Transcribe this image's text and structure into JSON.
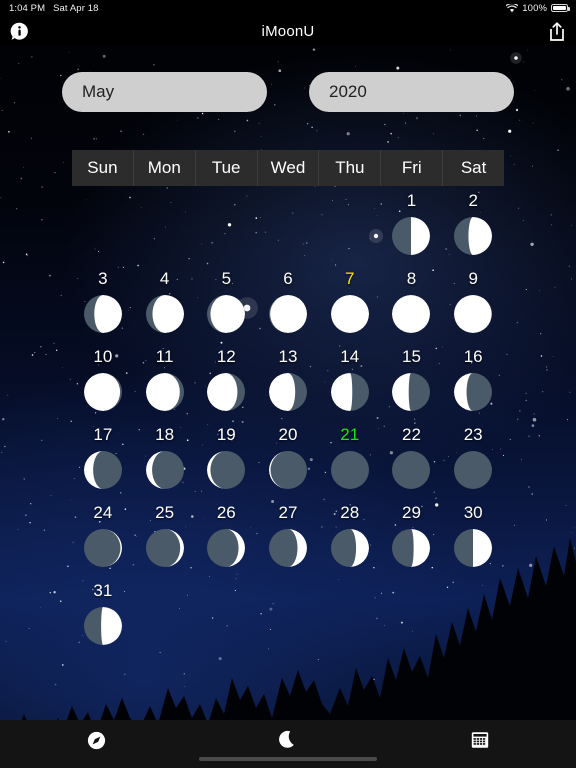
{
  "status_bar": {
    "time": "1:04 PM",
    "date": "Sat Apr 18",
    "wifi_icon": "wifi-icon",
    "battery_percent": "100%"
  },
  "title_bar": {
    "app_title": "iMoonU",
    "info_icon": "info-icon",
    "share_icon": "share-icon"
  },
  "selectors": {
    "month": "May",
    "year": "2020"
  },
  "day_headers": [
    "Sun",
    "Mon",
    "Tue",
    "Wed",
    "Thu",
    "Fri",
    "Sat"
  ],
  "colors": {
    "moon_dark": "#4b5a68",
    "moon_light": "#ffffff",
    "full_moon_label": "#ffe400",
    "new_moon_label": "#12e612",
    "header_bar": "#2c2c2c",
    "selector_field": "#cfcfcf",
    "tabbar": "#141414"
  },
  "tab_bar": {
    "tabs": [
      {
        "name": "compass-tab",
        "icon": "compass-icon",
        "label": ""
      },
      {
        "name": "moon-tab",
        "icon": "moon-icon",
        "label": ""
      },
      {
        "name": "calendar-tab",
        "icon": "calendar-icon",
        "label": ""
      }
    ]
  },
  "calendar": {
    "month": "May",
    "year": "2020",
    "first_day_column": 5,
    "days_in_month": 31,
    "weeks": [
      [
        null,
        null,
        null,
        null,
        null,
        1,
        2
      ],
      [
        3,
        4,
        5,
        6,
        7,
        8,
        9
      ],
      [
        10,
        11,
        12,
        13,
        14,
        15,
        16
      ],
      [
        17,
        18,
        19,
        20,
        21,
        22,
        23
      ],
      [
        24,
        25,
        26,
        27,
        28,
        29,
        30
      ],
      [
        31,
        null,
        null,
        null,
        null,
        null,
        null
      ]
    ],
    "days": [
      {
        "day": 1,
        "phase": "first-quarter",
        "illumination": 0.5,
        "lit_side": "right",
        "highlight": "none"
      },
      {
        "day": 2,
        "phase": "waxing-gibbous",
        "illumination": 0.62,
        "lit_side": "right",
        "highlight": "none"
      },
      {
        "day": 3,
        "phase": "waxing-gibbous",
        "illumination": 0.73,
        "lit_side": "right",
        "highlight": "none"
      },
      {
        "day": 4,
        "phase": "waxing-gibbous",
        "illumination": 0.83,
        "lit_side": "right",
        "highlight": "none"
      },
      {
        "day": 5,
        "phase": "waxing-gibbous",
        "illumination": 0.91,
        "lit_side": "right",
        "highlight": "none"
      },
      {
        "day": 6,
        "phase": "waxing-gibbous",
        "illumination": 0.97,
        "lit_side": "right",
        "highlight": "none"
      },
      {
        "day": 7,
        "phase": "full-moon",
        "illumination": 1.0,
        "lit_side": "right",
        "highlight": "full"
      },
      {
        "day": 8,
        "phase": "full-moon",
        "illumination": 1.0,
        "lit_side": "left",
        "highlight": "none"
      },
      {
        "day": 9,
        "phase": "waning-gibbous",
        "illumination": 0.99,
        "lit_side": "left",
        "highlight": "none"
      },
      {
        "day": 10,
        "phase": "waning-gibbous",
        "illumination": 0.95,
        "lit_side": "left",
        "highlight": "none"
      },
      {
        "day": 11,
        "phase": "waning-gibbous",
        "illumination": 0.89,
        "lit_side": "left",
        "highlight": "none"
      },
      {
        "day": 12,
        "phase": "waning-gibbous",
        "illumination": 0.8,
        "lit_side": "left",
        "highlight": "none"
      },
      {
        "day": 13,
        "phase": "waning-gibbous",
        "illumination": 0.69,
        "lit_side": "left",
        "highlight": "none"
      },
      {
        "day": 14,
        "phase": "last-quarter",
        "illumination": 0.56,
        "lit_side": "left",
        "highlight": "none"
      },
      {
        "day": 15,
        "phase": "last-quarter",
        "illumination": 0.44,
        "lit_side": "left",
        "highlight": "none"
      },
      {
        "day": 16,
        "phase": "waning-crescent",
        "illumination": 0.33,
        "lit_side": "left",
        "highlight": "none"
      },
      {
        "day": 17,
        "phase": "waning-crescent",
        "illumination": 0.24,
        "lit_side": "left",
        "highlight": "none"
      },
      {
        "day": 18,
        "phase": "waning-crescent",
        "illumination": 0.16,
        "lit_side": "left",
        "highlight": "none"
      },
      {
        "day": 19,
        "phase": "waning-crescent",
        "illumination": 0.09,
        "lit_side": "left",
        "highlight": "none"
      },
      {
        "day": 20,
        "phase": "waning-crescent",
        "illumination": 0.04,
        "lit_side": "left",
        "highlight": "none"
      },
      {
        "day": 21,
        "phase": "new-moon",
        "illumination": 0.0,
        "lit_side": "left",
        "highlight": "new"
      },
      {
        "day": 22,
        "phase": "new-moon",
        "illumination": 0.0,
        "lit_side": "right",
        "highlight": "none"
      },
      {
        "day": 23,
        "phase": "new-moon",
        "illumination": 0.0,
        "lit_side": "right",
        "highlight": "none"
      },
      {
        "day": 24,
        "phase": "waxing-crescent",
        "illumination": 0.04,
        "lit_side": "right",
        "highlight": "none"
      },
      {
        "day": 25,
        "phase": "waxing-crescent",
        "illumination": 0.1,
        "lit_side": "right",
        "highlight": "none"
      },
      {
        "day": 26,
        "phase": "waxing-crescent",
        "illumination": 0.17,
        "lit_side": "right",
        "highlight": "none"
      },
      {
        "day": 27,
        "phase": "waxing-crescent",
        "illumination": 0.25,
        "lit_side": "right",
        "highlight": "none"
      },
      {
        "day": 28,
        "phase": "waxing-crescent",
        "illumination": 0.34,
        "lit_side": "right",
        "highlight": "none"
      },
      {
        "day": 29,
        "phase": "waxing-crescent",
        "illumination": 0.43,
        "lit_side": "right",
        "highlight": "none"
      },
      {
        "day": 30,
        "phase": "first-quarter",
        "illumination": 0.5,
        "lit_side": "right",
        "highlight": "none"
      },
      {
        "day": 31,
        "phase": "first-quarter",
        "illumination": 0.55,
        "lit_side": "right",
        "highlight": "none"
      }
    ]
  }
}
